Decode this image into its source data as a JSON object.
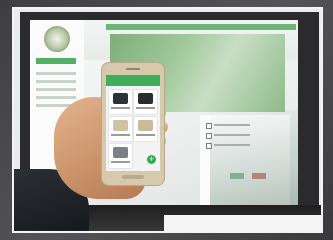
{
  "phone_app": {
    "cards": [
      {
        "icon": "black-valve-device-icon",
        "color": "#2f3235"
      },
      {
        "icon": "black-valve-device-icon",
        "color": "#2a2d30"
      },
      {
        "icon": "beige-valve-device-icon",
        "color": "#cfc2a3"
      },
      {
        "icon": "beige-valve-device-icon",
        "color": "#c8bb9c"
      },
      {
        "icon": "grey-valve-device-icon",
        "color": "#7c8085"
      }
    ],
    "fab_symbol": "+"
  },
  "colors": {
    "accent_green": "#3fae5a",
    "button_red": "#c9564a",
    "hand_skin": "#d9a47f",
    "monitor_bezel": "#2b2b2d"
  }
}
